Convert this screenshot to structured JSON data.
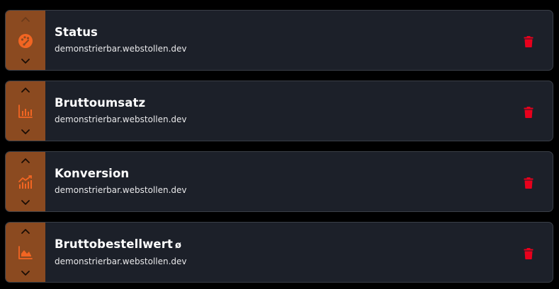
{
  "colors": {
    "page_background": "#000000",
    "card_background": "#1c2029",
    "card_border": "#3a3f47",
    "handle_background": "#8b4a20",
    "icon_accent": "#f26522",
    "delete_red": "#e8001c",
    "text_primary": "#ffffff"
  },
  "widgets": [
    {
      "title": "Status",
      "title_suffix": "",
      "subtitle": "demonstrierbar.webstollen.dev",
      "icon": "palette-icon",
      "can_move_up": false,
      "can_move_down": true
    },
    {
      "title": "Bruttoumsatz",
      "title_suffix": "",
      "subtitle": "demonstrierbar.webstollen.dev",
      "icon": "bar-chart-icon",
      "can_move_up": true,
      "can_move_down": true
    },
    {
      "title": "Konversion",
      "title_suffix": "",
      "subtitle": "demonstrierbar.webstollen.dev",
      "icon": "chart-trend-icon",
      "can_move_up": true,
      "can_move_down": true
    },
    {
      "title": "Bruttobestellwert",
      "title_suffix": "ø",
      "subtitle": "demonstrierbar.webstollen.dev",
      "icon": "area-chart-icon",
      "can_move_up": true,
      "can_move_down": true
    }
  ]
}
